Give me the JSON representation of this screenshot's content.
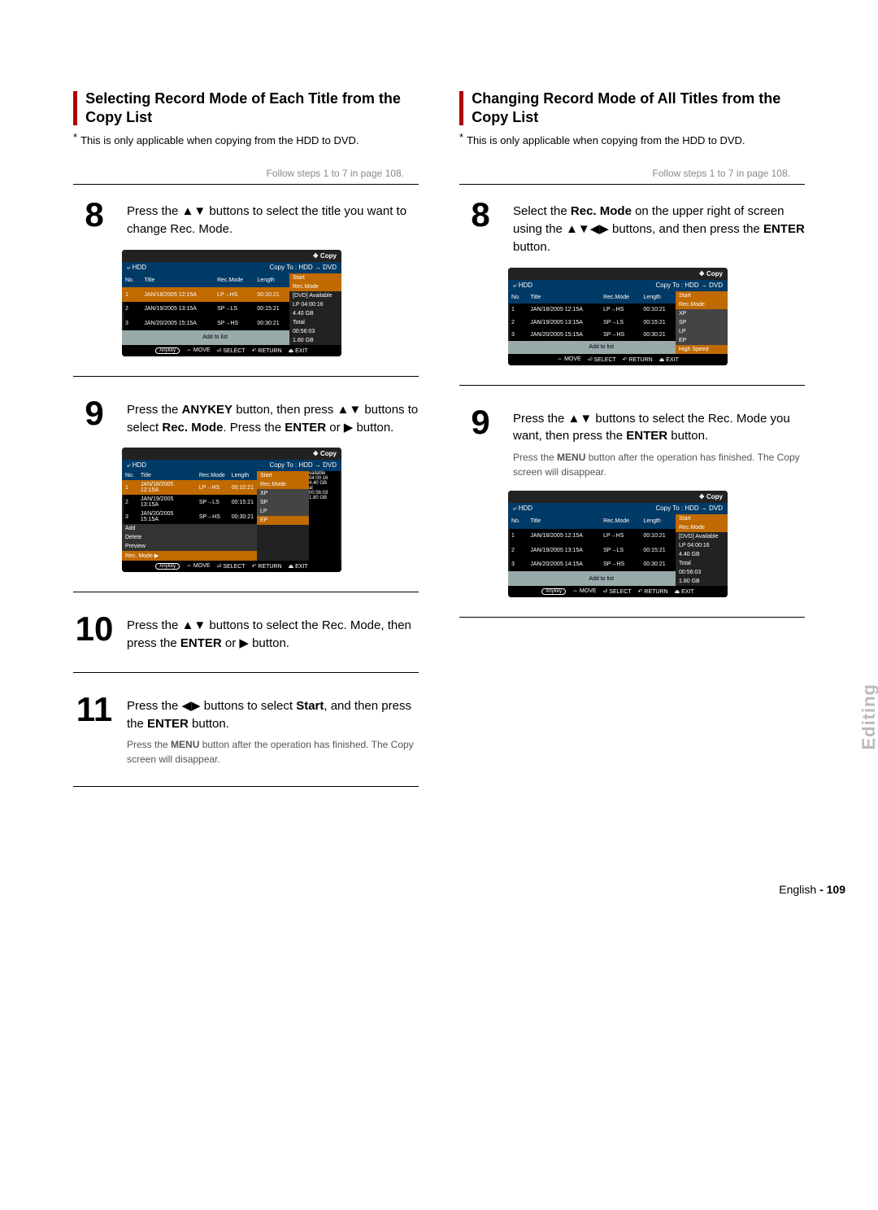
{
  "left": {
    "heading": "Selecting Record Mode of Each Title from the Copy List",
    "note": "This is only applicable when copying from the HDD to DVD.",
    "follow": "Follow steps 1 to 7 in page 108.",
    "step8": {
      "num": "8",
      "text_a": "Press the ",
      "arrows": "▲▼",
      "text_b": " buttons to select the title you want to change Rec. Mode."
    },
    "osd1": {
      "toplabel": "❖  Copy",
      "hdd": "HDD",
      "copyto": "Copy To : HDD → DVD",
      "headers": [
        "No.",
        "Title",
        "Rec.Mode",
        "Length"
      ],
      "rows": [
        [
          "1",
          "JAN/18/2005 12:15A",
          "LP→HS",
          "00:10:21"
        ],
        [
          "2",
          "JAN/19/2005 13:15A",
          "SP→LS",
          "00:15:21"
        ],
        [
          "3",
          "JAN/20/2005 15:15A",
          "SP→HS",
          "00:30:21"
        ]
      ],
      "addrow": "Add to list",
      "side": [
        "Start",
        "Rec.Mode",
        "[DVD] Available",
        "LP    04:00:16",
        "4.40 GB",
        "Total",
        "00:56:03",
        "1.80 GB"
      ],
      "footer": [
        "Anykey",
        "⇔ MOVE",
        "⏎ SELECT",
        "↶ RETURN",
        "⏏ EXIT"
      ]
    },
    "step9": {
      "num": "9",
      "text_a": "Press the ",
      "anykey": "ANYKEY",
      "text_b": " button, then press ",
      "arrows": "▲▼",
      "text_c": " buttons to select ",
      "recmode": "Rec. Mode",
      "text_d": ". Press the ",
      "enter": "ENTER",
      "text_e": " or ▶ button."
    },
    "osd2": {
      "toplabel": "❖  Copy",
      "hdd": "HDD",
      "copyto": "Copy To : HDD → DVD",
      "headers": [
        "No.",
        "Title",
        "Rec.Mode",
        "Length"
      ],
      "rows": [
        [
          "1",
          "JAN/18/2005 12:15A",
          "LP→HS",
          "00:10:21"
        ],
        [
          "2",
          "JAN/19/2005 13:15A",
          "SP→LS",
          "00:15:21"
        ],
        [
          "3",
          "JAN/20/2005 15:15A",
          "SP→HS",
          "00:30:21"
        ]
      ],
      "menu": [
        "Add",
        "Delete",
        "Preview",
        "Rec. Mode   ▶"
      ],
      "side": [
        "Start",
        "Rec.Mode",
        "XP",
        "SP",
        "LP",
        "EP"
      ],
      "sideExtra": [
        "vailable",
        "04:00:16",
        "4.40 GB",
        "al",
        "00:56:03",
        "1.80 GB"
      ],
      "footer": [
        "Anykey",
        "⇔ MOVE",
        "⏎ SELECT",
        "↶ RETURN",
        "⏏ EXIT"
      ]
    },
    "step10": {
      "num": "10",
      "text_a": "Press the ",
      "arrows": "▲▼",
      "text_b": " buttons to select the Rec. Mode, then press the ",
      "enter": "ENTER",
      "text_c": " or ▶ button."
    },
    "step11": {
      "num": "11",
      "text_a": "Press the ",
      "arrows": "◀▶",
      "text_b": " buttons to select ",
      "start": "Start",
      "text_c": ", and then press the ",
      "enter": "ENTER",
      "text_d": " button.",
      "line2_a": "Press the ",
      "line2_menu": "MENU",
      "line2_b": " button after the operation has finished. The Copy screen will disappear."
    }
  },
  "right": {
    "heading": "Changing Record Mode of All Titles from the Copy List",
    "note": "This is only applicable when copying from the HDD to DVD.",
    "follow": "Follow steps 1 to 7 in page 108.",
    "step8": {
      "num": "8",
      "text_a": "Select the ",
      "recmode": "Rec. Mode",
      "text_b": " on the upper right of screen using the ",
      "arrows": "▲▼◀▶",
      "text_c": " buttons, and then press the ",
      "enter": "ENTER",
      "text_d": " button."
    },
    "osd1": {
      "toplabel": "❖  Copy",
      "hdd": "HDD",
      "copyto": "Copy To : HDD → DVD",
      "headers": [
        "No.",
        "Title",
        "Rec.Mode",
        "Length"
      ],
      "rows": [
        [
          "1",
          "JAN/18/2005 12:15A",
          "LP→HS",
          "00:10:21"
        ],
        [
          "2",
          "JAN/19/2005 13:15A",
          "SP→LS",
          "00:15:21"
        ],
        [
          "3",
          "JAN/20/2005 15:15A",
          "SP→HS",
          "00:30:21"
        ]
      ],
      "addrow": "Add to list",
      "side": [
        "Start",
        "Rec.Mode",
        "XP",
        "SP",
        "LP",
        "EP",
        "High Speed"
      ],
      "footer": [
        "⇔ MOVE",
        "⏎ SELECT",
        "↶ RETURN",
        "⏏ EXIT"
      ]
    },
    "step9": {
      "num": "9",
      "text_a": "Press the ",
      "arrows": "▲▼",
      "text_b": " buttons to select the Rec. Mode you want, then press the ",
      "enter": "ENTER",
      "text_c": " button.",
      "line2_a": "Press the ",
      "line2_menu": "MENU",
      "line2_b": " button after the operation has finished. The Copy screen will disappear."
    },
    "osd2": {
      "toplabel": "❖  Copy",
      "hdd": "HDD",
      "copyto": "Copy To : HDD → DVD",
      "headers": [
        "No.",
        "Title",
        "Rec.Mode",
        "Length"
      ],
      "rows": [
        [
          "1",
          "JAN/18/2005 12:15A",
          "LP→HS",
          "00:10:21"
        ],
        [
          "2",
          "JAN/19/2005 13:15A",
          "SP→LS",
          "00:15:21"
        ],
        [
          "3",
          "JAN/20/2005 14:15A",
          "SP→HS",
          "00:30:21"
        ]
      ],
      "addrow": "Add to list",
      "side": [
        "Start",
        "Rec.Mode",
        "[DVD] Available",
        "LP    04:00:16",
        "4.40 GB",
        "Total",
        "00:56:03",
        "1.80 GB"
      ],
      "footer": [
        "Anykey",
        "⇔ MOVE",
        "⏎ SELECT",
        "↶ RETURN",
        "⏏ EXIT"
      ]
    }
  },
  "pagelabel": "English",
  "pagenum": "- 109",
  "sidetab": "Editing"
}
